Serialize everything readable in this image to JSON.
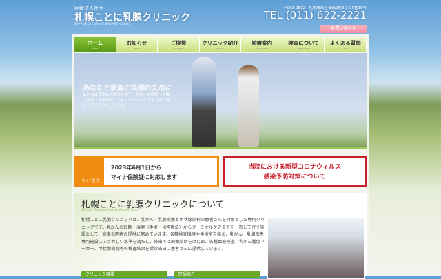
{
  "header": {
    "corp": "医療法人社団",
    "title": "札幌ことに乳腺クリニック",
    "subtitle": "SAPPORO-KOTONI BREAST CLINIC",
    "address": "〒063-0812　札幌市西区琴似2条2丁目5番15号",
    "tel": "TEL (011) 622-2221",
    "button": "お問い合わせ"
  },
  "nav": [
    {
      "label": "ホーム",
      "en": "HOME"
    },
    {
      "label": "お知らせ",
      "en": "NEWS"
    },
    {
      "label": "ご挨拶",
      "en": "MESSAGE"
    },
    {
      "label": "クリニック紹介",
      "en": "ABOUT"
    },
    {
      "label": "診療案内",
      "en": "TREATMENT"
    },
    {
      "label": "検査について",
      "en": "INSPECTION"
    },
    {
      "label": "よくある質問",
      "en": "Q&A"
    }
  ],
  "hero": {
    "catch": "あなたと家族の笑顔のために",
    "text": "私たちは豊富な経験と技術で、乳がんの診断・治療（手術・化学療法）からターミナルケアまでを一貫して行うクリニックです。"
  },
  "banners": {
    "mynumber": {
      "line1": "2023年6月1日から",
      "line2": "マイナ保険証に対応します",
      "badge": "マイナ受付"
    },
    "covid": {
      "line1": "当院における新型コロナウィルス",
      "line2": "感染予防対策について"
    }
  },
  "about": {
    "title": "札幌ことに乳腺クリニックについて",
    "subtitle": "What's \"Sapporo-Kotoni Breast Clinic\"",
    "body": "札幌ことに乳腺クリニックは、乳がん・乳腺疾患と甲状腺外科の患者さんを対象とした専門クリニックです。乳がんの診断・治療（手術・化学療法）からターミナルケアまでを一貫して行う施設として、高度な医療の提供に努めています。各種検査機器や手術室を揃え、乳がん・乳腺疾患専門施設にふさわしい水準を満たし、外来では画像診断をはじめ、各種血液検査、乳がん腫瘍マーカー、甲状腺機能等の検査結果を受診当日に患者さんに提供しています。",
    "tabs": [
      "クリニック概要",
      "医師紹介"
    ]
  }
}
